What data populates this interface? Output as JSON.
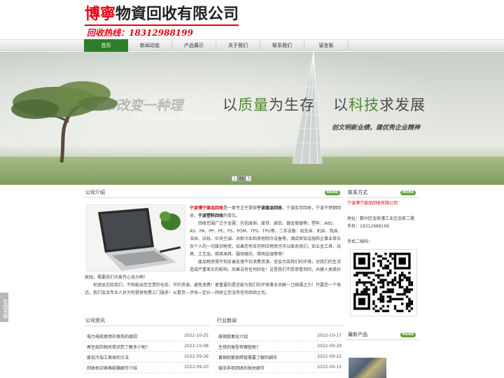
{
  "header": {
    "logo_red": "博寧",
    "logo_black": "物資回收有限公司",
    "hotline": "回收热线：18312988199"
  },
  "nav": {
    "items": [
      {
        "label": "首页",
        "active": true
      },
      {
        "label": "新闻动态",
        "active": false
      },
      {
        "label": "产品展示",
        "active": false
      },
      {
        "label": "关于我们",
        "active": false
      },
      {
        "label": "联系我们",
        "active": false
      },
      {
        "label": "留言板",
        "active": false
      }
    ]
  },
  "banner": {
    "ghost_text": "城市改变一种理",
    "ghost_sub": "TO CHANGE A CONCEPT",
    "slogan1_a": "以",
    "slogan1_b": "质量",
    "slogan1_c": "为生存",
    "slogan2_a": "以",
    "slogan2_b": "科技",
    "slogan2_c": "求发展",
    "tagline": "创文明新业绩，建优秀企业精神",
    "pages": [
      "1",
      "2",
      "3"
    ],
    "active_page": "2"
  },
  "side_tab": {
    "label": "在线客服"
  },
  "intro": {
    "title": "公司介绍",
    "more": "MORE",
    "company": "宁波博宁废品回收",
    "p1a": "是一家专注于提供",
    "p1b": "宁波废品回收",
    "p1c": "，宁波库存回收，宁波不锈钢回收，",
    "p1d": "宁波塑料回收",
    "p1e": "的单位。",
    "p2": "回收范围广泛于金属：包括废铜、废铁、废铝、镀金镀银等；塑料：ABS、AS、PA、PP、PE、PS、POM、TPS、TPU等，二手设备：如车床、机床、铣床、冲床、压机、中央空调、冰柜冷库和其他制冷设备等，酒店宾馆设施和企事业单位及个人的一切废旧物资。如果您有库存积压物资也可以联系我们，如五金工具、玩具、工艺品、照具渔具、服饰箱包、照明设施等等！",
    "p3": "废品物资得不到妥善处理不仅浪费资源，还会污染我们的环境，对我们的生活造成严重差劣的影响，后果没有任何好处！这是我们不愿意看到的，共建人类美好家园，需要我们大家齐心协力啊！",
    "p4": "祀逐品交给我们，不但能出您宝贵的仓库、节约资源，避免浪费！更重要的是还能为我们的环保事业贡献一己绵薄之力！只要您一个电话，我们会派专业人员为你提供免费上门服务！从看货—评估—定价—回收让您没有任何后顾之忧。"
  },
  "contact": {
    "title": "联系方式",
    "more": "MORE",
    "company": "宁波博宁废品回收有限公司",
    "address": "地址：鄞州区金家漕工业区金家二路",
    "phone": "手机：18312988199",
    "qr_label": "手机二维码："
  },
  "company_news": {
    "title": "公司资讯",
    "items": [
      {
        "title": "电力电缆使用中发热的原因",
        "date": "2022-10-25"
      },
      {
        "title": "再生纸的相关常识您了解多少呢?",
        "date": "2022-10-08"
      },
      {
        "title": "废铝冷加工具体的方法",
        "date": "2022-09-26"
      },
      {
        "title": "回收机印表格纸箱细节介绍",
        "date": "2022-09-20"
      }
    ]
  },
  "industry_news": {
    "title": "行业新闻",
    "items": [
      {
        "title": "废钢肌氧化介绍",
        "date": "2022-10-17"
      },
      {
        "title": "生铁的类型有哪些呢?",
        "date": "2022-09-29"
      },
      {
        "title": "黄铜和紫铜焊接需要了解的细节",
        "date": "2022-09-22"
      },
      {
        "title": "废旧手机回收的相关细节",
        "date": "2022-09-15"
      }
    ]
  },
  "latest_products": {
    "title": "最新产品",
    "more": "MORE"
  },
  "colors": {
    "brand_red": "#e60012",
    "nav_active": "#2e7d2a",
    "more_badge": "#5fa23b"
  }
}
